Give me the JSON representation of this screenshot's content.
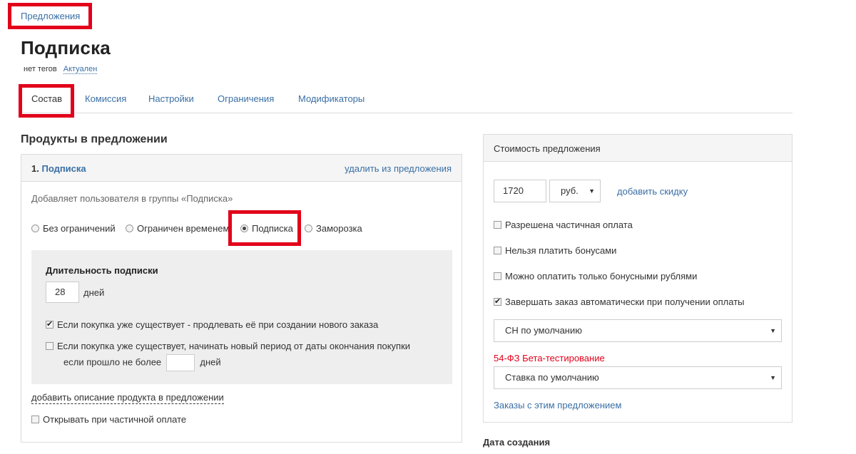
{
  "breadcrumb": "Предложения",
  "page_title": "Подписка",
  "tags": {
    "no_tags": "нет тегов",
    "status": "Актуален"
  },
  "tabs": [
    "Состав",
    "Комиссия",
    "Настройки",
    "Ограничения",
    "Модификаторы"
  ],
  "products": {
    "heading": "Продукты в предложении",
    "item": {
      "number": "1.",
      "name": "Подписка",
      "remove": "удалить из предложения",
      "description": "Добавляет пользователя в группы «Подписка»",
      "modes": [
        {
          "label": "Без ограничений",
          "selected": false
        },
        {
          "label": "Ограничен временем",
          "selected": false
        },
        {
          "label": "Подписка",
          "selected": true
        },
        {
          "label": "Заморозка",
          "selected": false
        }
      ],
      "duration": {
        "label": "Длительность подписки",
        "value": "28",
        "unit": "дней",
        "extend_option": {
          "label": "Если покупка уже существует - продлевать её при создании нового заказа",
          "checked": true
        },
        "new_period_option": {
          "line1": "Если покупка уже существует, начинать новый период от даты окончания покупки",
          "line2_prefix": "если прошло не более",
          "line2_suffix": "дней",
          "checked": false
        }
      },
      "add_description": "добавить описание продукта в предложении",
      "open_on_partial": {
        "label": "Открывать при частичной оплате",
        "checked": false
      }
    }
  },
  "cost": {
    "title": "Стоимость предложения",
    "price": "1720",
    "currency": "руб.",
    "add_discount": "добавить скидку",
    "options": [
      {
        "label": "Разрешена частичная оплата",
        "checked": false
      },
      {
        "label": "Нельзя платить бонусами",
        "checked": false
      },
      {
        "label": "Можно оплатить только бонусными рублями",
        "checked": false
      },
      {
        "label": "Завершать заказ автоматически при получении оплаты",
        "checked": true
      }
    ],
    "tax_system": "СН по умолчанию",
    "fz_label": "54-ФЗ Бета-тестирование",
    "vat_rate": "Ставка по умолчанию",
    "orders_link": "Заказы с этим предложением"
  },
  "created_label": "Дата создания",
  "colors": {
    "link": "#3a6fa5",
    "highlight": "#e2001a",
    "panel_header": "#f5f5f5",
    "duration_bg": "#eeeeee"
  }
}
